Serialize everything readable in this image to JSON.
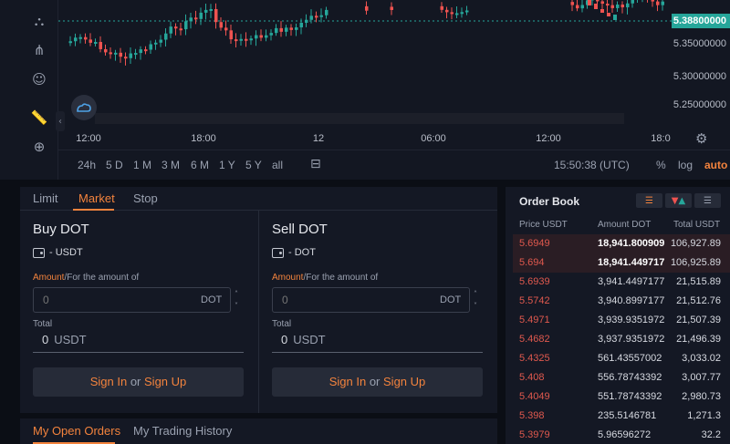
{
  "chart": {
    "current_price": "5.38800000",
    "price_labels": [
      "5.35000000",
      "5.30000000",
      "5.25000000"
    ],
    "time_labels": [
      "12:00",
      "18:00",
      "12",
      "06:00",
      "12:00",
      "18:0"
    ],
    "ranges": [
      "24h",
      "5 D",
      "1 M",
      "3 M",
      "6 M",
      "1 Y",
      "5 Y",
      "all"
    ],
    "clock": "15:50:38 (UTC)",
    "options": [
      "%",
      "log",
      "auto"
    ],
    "colors": {
      "up": "#26a69a",
      "down": "#ef5350",
      "current": "#26a69a",
      "accent": "#f3833d"
    },
    "icons": [
      "node-tool-icon",
      "fork-tool-icon",
      "sliders-tool-icon",
      "emoji-tool-icon",
      "ruler-icon",
      "zoom-in-icon",
      "calendar-icon",
      "gear-icon"
    ]
  },
  "trade": {
    "tabs": [
      "Limit",
      "Market",
      "Stop"
    ],
    "active_tab": "Market",
    "buy": {
      "title": "Buy DOT",
      "wallet": "- USDT",
      "amount_label_hl": "Amount",
      "amount_label_rest": "/For the amount of",
      "amount_placeholder": "0",
      "amount_unit": "DOT",
      "total_label": "Total",
      "total_value": "0",
      "total_unit": "USDT",
      "signin": "Sign In",
      "or": "or",
      "signup": "Sign Up"
    },
    "sell": {
      "title": "Sell DOT",
      "wallet": "- DOT",
      "amount_label_hl": "Amount",
      "amount_label_rest": "/For the amount of",
      "amount_placeholder": "0",
      "amount_unit": "DOT",
      "total_label": "Total",
      "total_value": "0",
      "total_unit": "USDT",
      "signin": "Sign In",
      "or": "or",
      "signup": "Sign Up"
    }
  },
  "orders": {
    "tabs": [
      "My Open Orders",
      "My Trading History"
    ]
  },
  "orderbook": {
    "title": "Order Book",
    "headers": [
      "Price USDT",
      "Amount DOT",
      "Total USDT"
    ],
    "rows": [
      {
        "price": "5.6949",
        "amount": "18,941.800909",
        "total": "106,927.89"
      },
      {
        "price": "5.694",
        "amount": "18,941.449717",
        "total": "106,925.89"
      },
      {
        "price": "5.6939",
        "amount": "3,941.4497177",
        "total": "21,515.89"
      },
      {
        "price": "5.5742",
        "amount": "3,940.8997177",
        "total": "21,512.76"
      },
      {
        "price": "5.4971",
        "amount": "3,939.9351972",
        "total": "21,507.39"
      },
      {
        "price": "5.4682",
        "amount": "3,937.9351972",
        "total": "21,496.39"
      },
      {
        "price": "5.4325",
        "amount": "561.43557002",
        "total": "3,033.02"
      },
      {
        "price": "5.408",
        "amount": "556.78743392",
        "total": "3,007.77"
      },
      {
        "price": "5.4049",
        "amount": "551.78743392",
        "total": "2,980.73"
      },
      {
        "price": "5.398",
        "amount": "235.5146781",
        "total": "1,271.3"
      },
      {
        "price": "5.3979",
        "amount": "5.96596272",
        "total": "32.2"
      }
    ]
  }
}
